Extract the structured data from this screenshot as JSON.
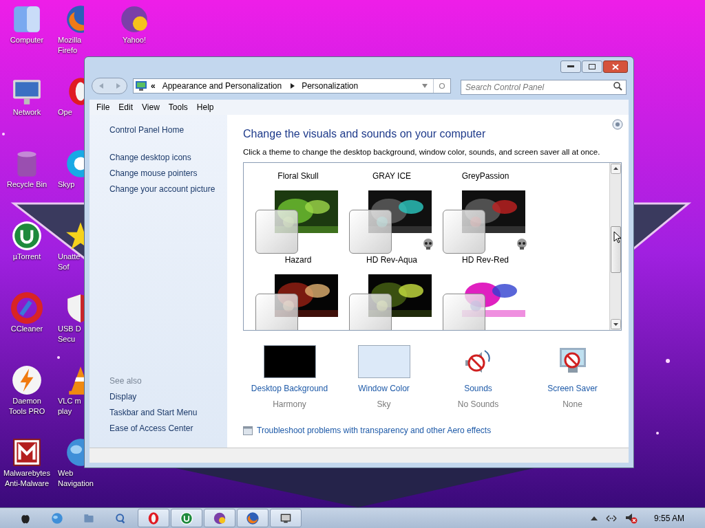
{
  "desktop_icons": [
    {
      "kind": "finder",
      "lines": [
        "Computer"
      ]
    },
    {
      "kind": "imac",
      "lines": [
        "Network"
      ]
    },
    {
      "kind": "bin",
      "lines": [
        "Recycle Bin"
      ]
    },
    {
      "kind": "torrent",
      "lines": [
        "µTorrent"
      ]
    },
    {
      "kind": "cleaner",
      "lines": [
        "CCleaner"
      ]
    },
    {
      "kind": "bolt",
      "lines": [
        "Daemon",
        "Tools PRO"
      ]
    },
    {
      "kind": "malware",
      "lines": [
        "Malwarebytes",
        "Anti-Malware"
      ]
    },
    {
      "kind": "firefox",
      "lines": [
        "Mozilla",
        "Firefo"
      ]
    },
    {
      "kind": "opera",
      "lines": [
        "Ope"
      ]
    },
    {
      "kind": "skype",
      "lines": [
        "Skyp"
      ]
    },
    {
      "kind": "star",
      "lines": [
        "Unatte",
        "Sof"
      ]
    },
    {
      "kind": "shield",
      "lines": [
        "USB D",
        "Secu"
      ]
    },
    {
      "kind": "cone",
      "lines": [
        "VLC m",
        "play"
      ]
    },
    {
      "kind": "globe",
      "lines": [
        "Web",
        "Navigation"
      ]
    },
    {
      "kind": "messenger",
      "lines": [
        "Yahoo!"
      ]
    }
  ],
  "window": {
    "address": {
      "crumbs": [
        "«",
        "Appearance and Personalization",
        "Personalization"
      ]
    },
    "search": {
      "placeholder": "Search Control Panel"
    },
    "menu": [
      "File",
      "Edit",
      "View",
      "Tools",
      "Help"
    ],
    "sidebar": {
      "home": "Control Panel Home",
      "links": [
        "Change desktop icons",
        "Change mouse pointers",
        "Change your account picture"
      ],
      "see_also_heading": "See also",
      "see_also": [
        "Display",
        "Taskbar and Start Menu",
        "Ease of Access Center"
      ]
    },
    "heading": "Change the visuals and sounds on your computer",
    "description": "Click a theme to change the desktop background, window color, sounds, and screen saver all at once.",
    "theme_rows": [
      {
        "kind": "labels",
        "themes": [
          {
            "label": "Floral Skull"
          },
          {
            "label": "GRAY ICE"
          },
          {
            "label": "GreyPassion"
          }
        ]
      },
      {
        "kind": "thumbs",
        "themes": [
          {
            "badge": false
          },
          {
            "badge": true
          },
          {
            "badge": true
          }
        ]
      },
      {
        "kind": "labels",
        "themes": [
          {
            "label": "Hazard"
          },
          {
            "label": "HD Rev-Aqua"
          },
          {
            "label": "HD Rev-Red"
          }
        ]
      },
      {
        "kind": "thumbs",
        "themes": [
          {
            "badge": false
          },
          {
            "badge": false
          },
          {
            "badge": false
          }
        ]
      }
    ],
    "settings": [
      {
        "kind": "swatch",
        "color": "#000000",
        "label": "Desktop Background",
        "value": "Harmony"
      },
      {
        "kind": "swatch",
        "color": "#dce9f8",
        "label": "Window Color",
        "value": "Sky"
      },
      {
        "kind": "sounds",
        "label": "Sounds",
        "value": "No Sounds"
      },
      {
        "kind": "saver",
        "label": "Screen Saver",
        "value": "None"
      }
    ],
    "troubleshoot_link": "Troubleshoot problems with transparency and other Aero effects"
  },
  "taskbar": {
    "quick_launch": [
      {
        "kind": "apple"
      },
      {
        "kind": "globe"
      },
      {
        "kind": "folder"
      },
      {
        "kind": "search"
      }
    ],
    "buttons": [
      {
        "kind": "opera"
      },
      {
        "kind": "torrent"
      },
      {
        "kind": "messenger"
      },
      {
        "kind": "firefox"
      },
      {
        "kind": "monitor"
      }
    ],
    "clock": "9:55 AM"
  }
}
